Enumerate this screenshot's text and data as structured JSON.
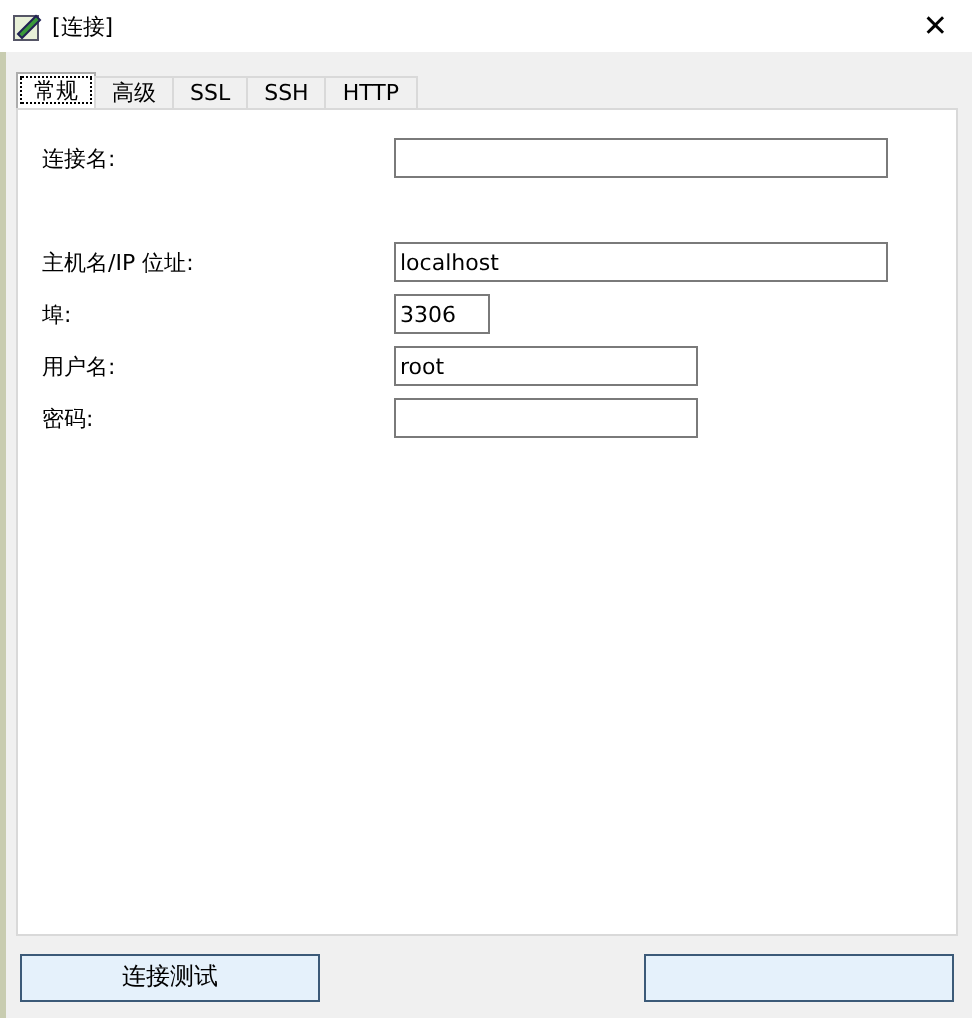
{
  "window": {
    "title": "[连接]",
    "close": "✕"
  },
  "tabs": [
    {
      "label": "常规",
      "selected": true
    },
    {
      "label": "高级",
      "selected": false
    },
    {
      "label": "SSL",
      "selected": false
    },
    {
      "label": "SSH",
      "selected": false
    },
    {
      "label": "HTTP",
      "selected": false
    }
  ],
  "fields": [
    {
      "label": "连接名:"
    },
    {
      "label": "主机名/IP 位址:",
      "value": "localhost"
    },
    {
      "label": "埠:",
      "value": "3306"
    },
    {
      "label": "用户名:",
      "value": "root"
    },
    {
      "label": "密码:"
    }
  ],
  "buttons": [
    "连接测试"
  ]
}
